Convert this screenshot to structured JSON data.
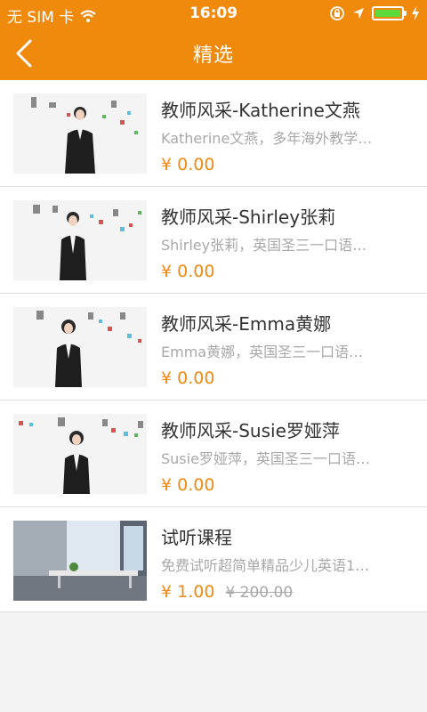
{
  "status_bar": {
    "carrier": "无 SIM 卡",
    "time": "16:09",
    "battery_level": 1.0
  },
  "nav": {
    "title": "精选",
    "back_icon": "chevron-left-icon"
  },
  "colors": {
    "accent": "#f08a0d",
    "price": "#ee8a15",
    "subtitle": "#a8a8a8"
  },
  "courses": [
    {
      "title": "教师风采-Katherine文燕",
      "desc": "Katherine文燕，多年海外教学…",
      "price": "¥ 0.00",
      "original_price": ""
    },
    {
      "title": "教师风采-Shirley张莉",
      "desc": "Shirley张莉，英国圣三一口语…",
      "price": "¥ 0.00",
      "original_price": ""
    },
    {
      "title": "教师风采-Emma黄娜",
      "desc": "Emma黄娜，英国圣三一口语…",
      "price": "¥ 0.00",
      "original_price": ""
    },
    {
      "title": "教师风采-Susie罗娅萍",
      "desc": "Susie罗娅萍，英国圣三一口语…",
      "price": "¥ 0.00",
      "original_price": ""
    },
    {
      "title": "试听课程",
      "desc": "免费试听超简单精品少儿英语1…",
      "price": "¥ 1.00",
      "original_price": "¥ 200.00"
    }
  ]
}
